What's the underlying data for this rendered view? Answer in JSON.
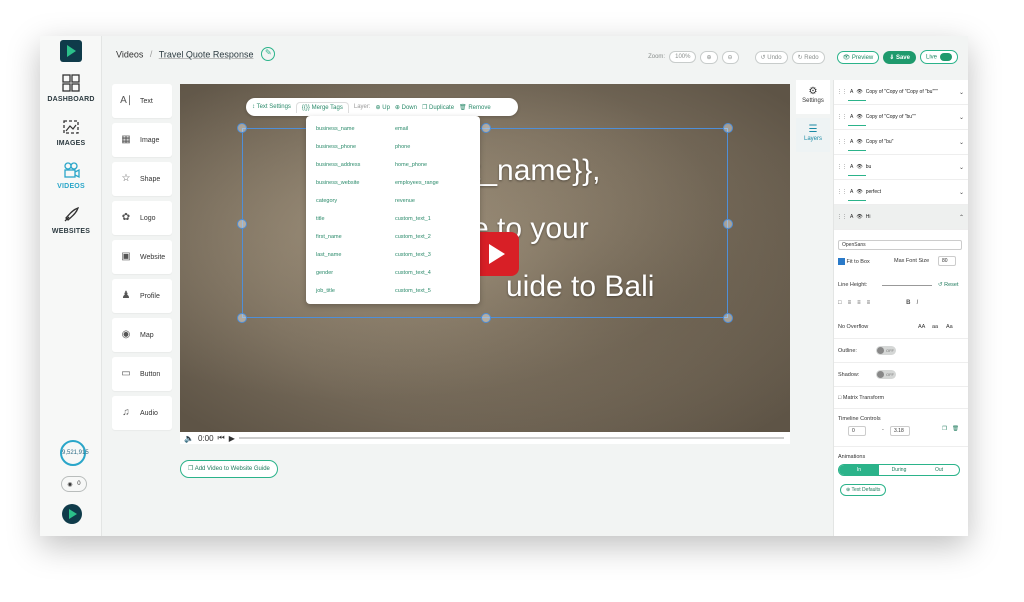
{
  "nav": {
    "items": [
      {
        "label": "DASHBOARD",
        "icon": "dashboard-icon"
      },
      {
        "label": "IMAGES",
        "icon": "images-icon"
      },
      {
        "label": "VIDEOS",
        "icon": "videos-icon",
        "active": true
      },
      {
        "label": "WEBSITES",
        "icon": "rocket-icon"
      }
    ],
    "credits": "9,521,915",
    "ideas_count": "0"
  },
  "header": {
    "section": "Videos",
    "separator": "/",
    "title": "Travel Quote Response",
    "zoom_label": "Zoom:",
    "zoom_value": "100%",
    "undo_label": "Undo",
    "redo_label": "Redo",
    "preview_label": "Preview",
    "save_label": "Save",
    "live_label": "Live"
  },
  "palette": [
    {
      "label": "Text",
      "icon": "text-icon"
    },
    {
      "label": "Image",
      "icon": "image-icon"
    },
    {
      "label": "Shape",
      "icon": "star-icon"
    },
    {
      "label": "Logo",
      "icon": "leaf-icon"
    },
    {
      "label": "Website",
      "icon": "website-icon"
    },
    {
      "label": "Profile",
      "icon": "profile-icon"
    },
    {
      "label": "Map",
      "icon": "map-pin-icon"
    },
    {
      "label": "Button",
      "icon": "button-icon"
    },
    {
      "label": "Audio",
      "icon": "audio-icon"
    }
  ],
  "canvas": {
    "line1": "{{first_name}},",
    "line1_visible": "t_name}},",
    "line2": "e to your",
    "line3_right": "uide to Bali",
    "time": "0:00"
  },
  "text_toolbar": {
    "text_settings": "Text Settings",
    "merge_tags": "Merge Tags",
    "layer_label": "Layer:",
    "up": "Up",
    "down": "Down",
    "duplicate": "Duplicate",
    "remove": "Remove"
  },
  "merge_tags": {
    "left": [
      "business_name",
      "business_phone",
      "business_address",
      "business_website",
      "category",
      "title",
      "first_name",
      "last_name",
      "gender",
      "job_title"
    ],
    "right": [
      "email",
      "phone",
      "home_phone",
      "employees_range",
      "revenue",
      "custom_text_1",
      "custom_text_2",
      "custom_text_3",
      "custom_text_4",
      "custom_text_5"
    ]
  },
  "add_guide_label": "Add Video to Website Guide",
  "right_tabs": [
    {
      "label": "Settings",
      "icon": "settings-icon"
    },
    {
      "label": "Layers",
      "icon": "layers-icon"
    }
  ],
  "layers": [
    {
      "name": "Copy of \"Copy of \"Copy of \"bu\"\"\""
    },
    {
      "name": "Copy of \"Copy of \"bu\"\""
    },
    {
      "name": "Copy of \"bu\""
    },
    {
      "name": "bu"
    },
    {
      "name": "perfect"
    },
    {
      "name": "Hi",
      "selected": true
    }
  ],
  "props": {
    "font": "OpenSans",
    "fit_to_box": "Fit to Box",
    "max_font_size_label": "Max Font Size",
    "max_font_size": "80",
    "line_height": "Line Height:",
    "reset": "Reset",
    "no_overflow": "No Overflow",
    "case_options": [
      "AA",
      "aa",
      "Aa"
    ],
    "outline": "Outline:",
    "shadow": "Shadow:",
    "off": "OFF",
    "matrix_transform": "Matrix Transform",
    "timeline_controls": "Timeline Controls",
    "timeline_start": "0",
    "timeline_dash": "-",
    "timeline_end": "3.18",
    "animations": "Animations",
    "anim_tabs": [
      "In",
      "During",
      "Out"
    ],
    "text_defaults": "Text Defaults"
  }
}
